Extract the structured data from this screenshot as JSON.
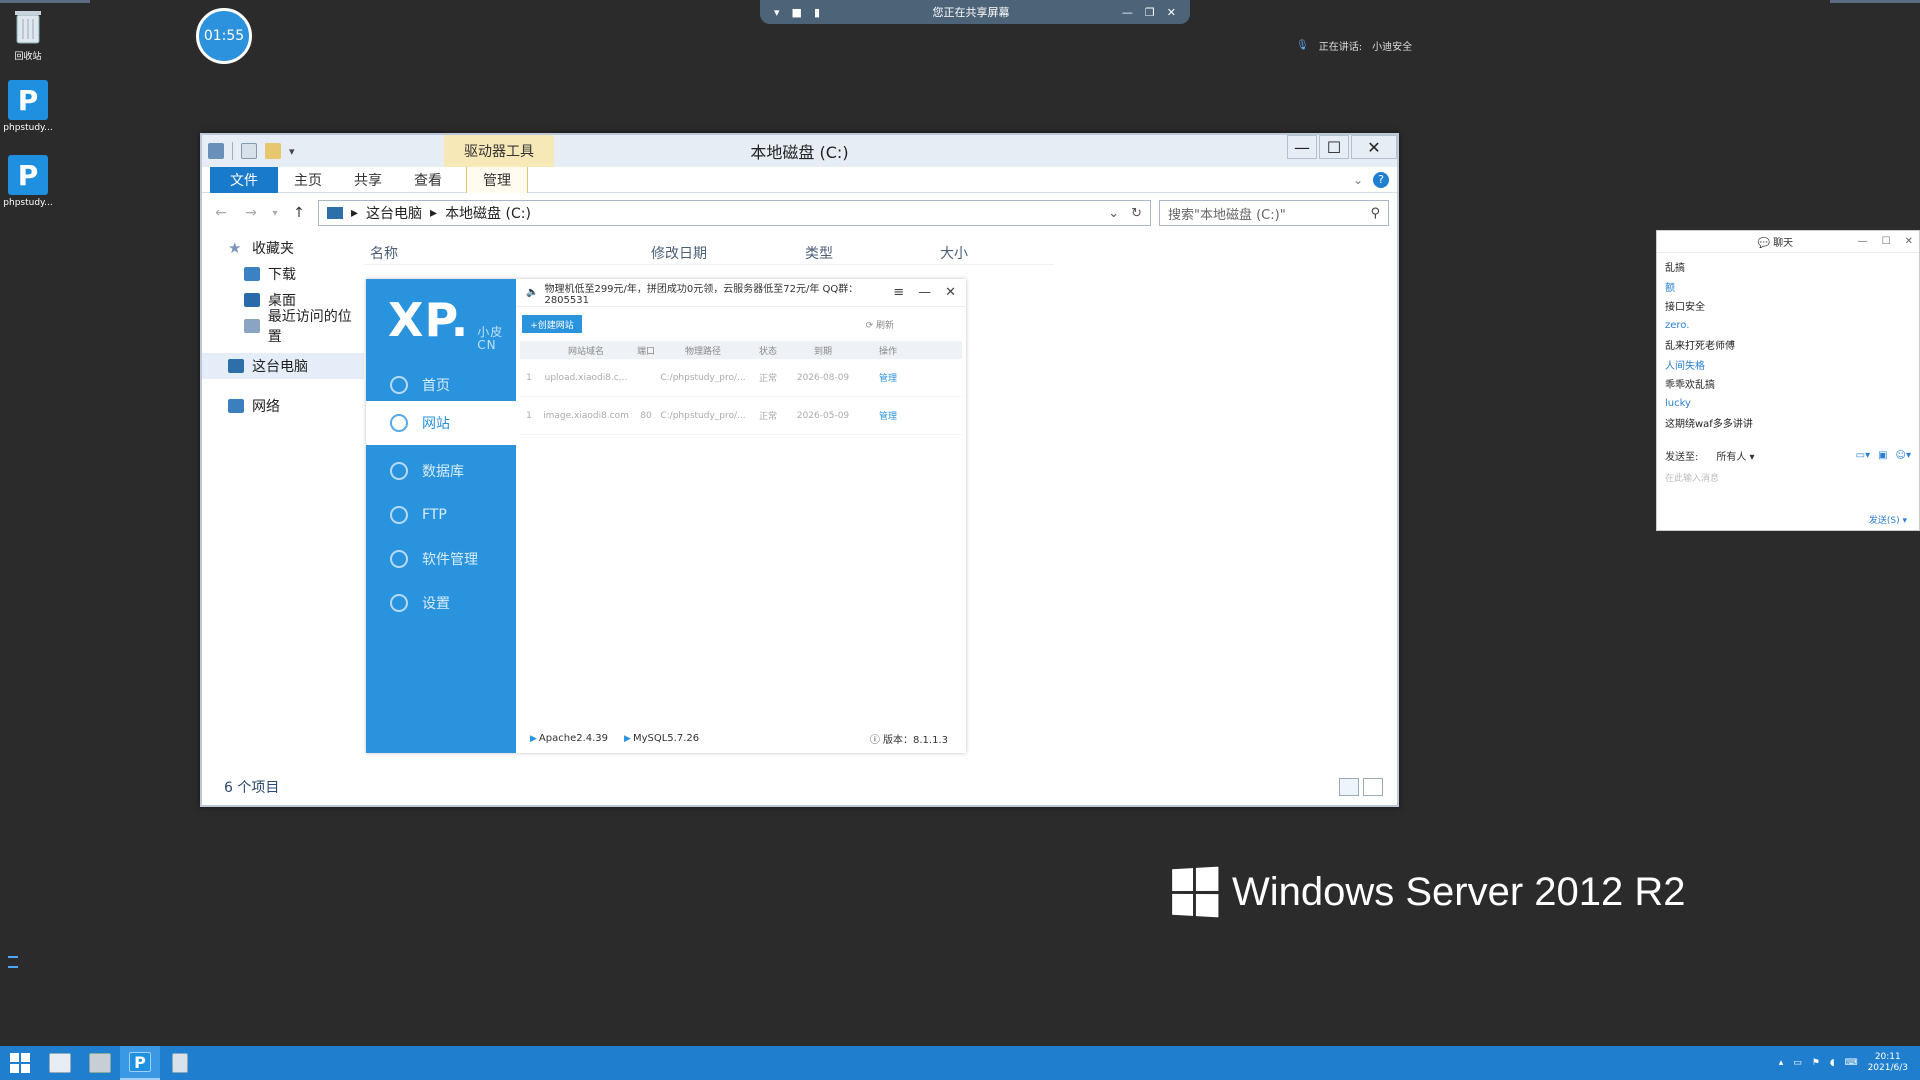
{
  "desktop": {
    "icons": [
      {
        "label": "回收站"
      },
      {
        "label": "phpstudy..."
      },
      {
        "label": "phpstudy..."
      }
    ],
    "timer": "01:55",
    "share_bar": {
      "text": "您正在共享屏幕"
    },
    "speaking": {
      "label": "正在讲话:",
      "name": "小迪安全"
    },
    "brand": "Windows Server 2012 R2"
  },
  "explorer": {
    "context_tab": "驱动器工具",
    "title": "本地磁盘 (C:)",
    "ribbon_tabs": [
      "文件",
      "主页",
      "共享",
      "查看",
      "管理"
    ],
    "address": {
      "segments": [
        "这台电脑",
        "本地磁盘 (C:)"
      ]
    },
    "search_placeholder": "搜索\"本地磁盘 (C:)\"",
    "nav": {
      "favorites": "收藏夹",
      "downloads": "下载",
      "desktop": "桌面",
      "recent": "最近访问的位置",
      "this_pc": "这台电脑",
      "network": "网络"
    },
    "columns": [
      "名称",
      "修改日期",
      "类型",
      "大小"
    ],
    "status": "6 个项目"
  },
  "phpstudy": {
    "logo_main": "XP.",
    "logo_sub1": "小皮",
    "logo_sub2": "CN",
    "nav": [
      "首页",
      "网站",
      "数据库",
      "FTP",
      "软件管理",
      "设置"
    ],
    "notice": "物理机低至299元/年，拼团成功0元领，云服务器低至72元/年  QQ群：2805531",
    "create_btn": "+创建网站",
    "refresh": "刷新",
    "headers": [
      "",
      "网站域名",
      "端口",
      "物理路径",
      "状态",
      "到期",
      "操作"
    ],
    "rows": [
      {
        "no": "1",
        "domain": "upload.xiaodi8.c...",
        "port": "",
        "path": "C:/phpstudy_pro/...",
        "status": "正常",
        "expire": "2026-08-09",
        "action": "管理"
      },
      {
        "no": "1",
        "domain": "image.xiaodi8.com",
        "port": "80",
        "path": "C:/phpstudy_pro/...",
        "status": "正常",
        "expire": "2026-05-09",
        "action": "管理"
      }
    ],
    "footer": {
      "apache": "Apache2.4.39",
      "mysql": "MySQL5.7.26",
      "version": "版本：8.1.1.3"
    }
  },
  "chat": {
    "title": "聊天",
    "messages": [
      "乱搞",
      "额",
      "接口安全",
      "zero.",
      "乱来打死老师傅",
      "人间失格",
      "乖乖欢乱搞",
      "lucky",
      "这期绕waf多多讲讲"
    ],
    "send_to_label": "发送至:",
    "send_to_value": "所有人",
    "input_placeholder": "在此输入消息",
    "send_button": "发送(S)"
  },
  "taskbar": {
    "time": "20:11",
    "date": "2021/6/3"
  },
  "colors": {
    "accent": "#2a93de",
    "taskbar": "#1f7fce",
    "desktop": "#2b2b2b"
  }
}
